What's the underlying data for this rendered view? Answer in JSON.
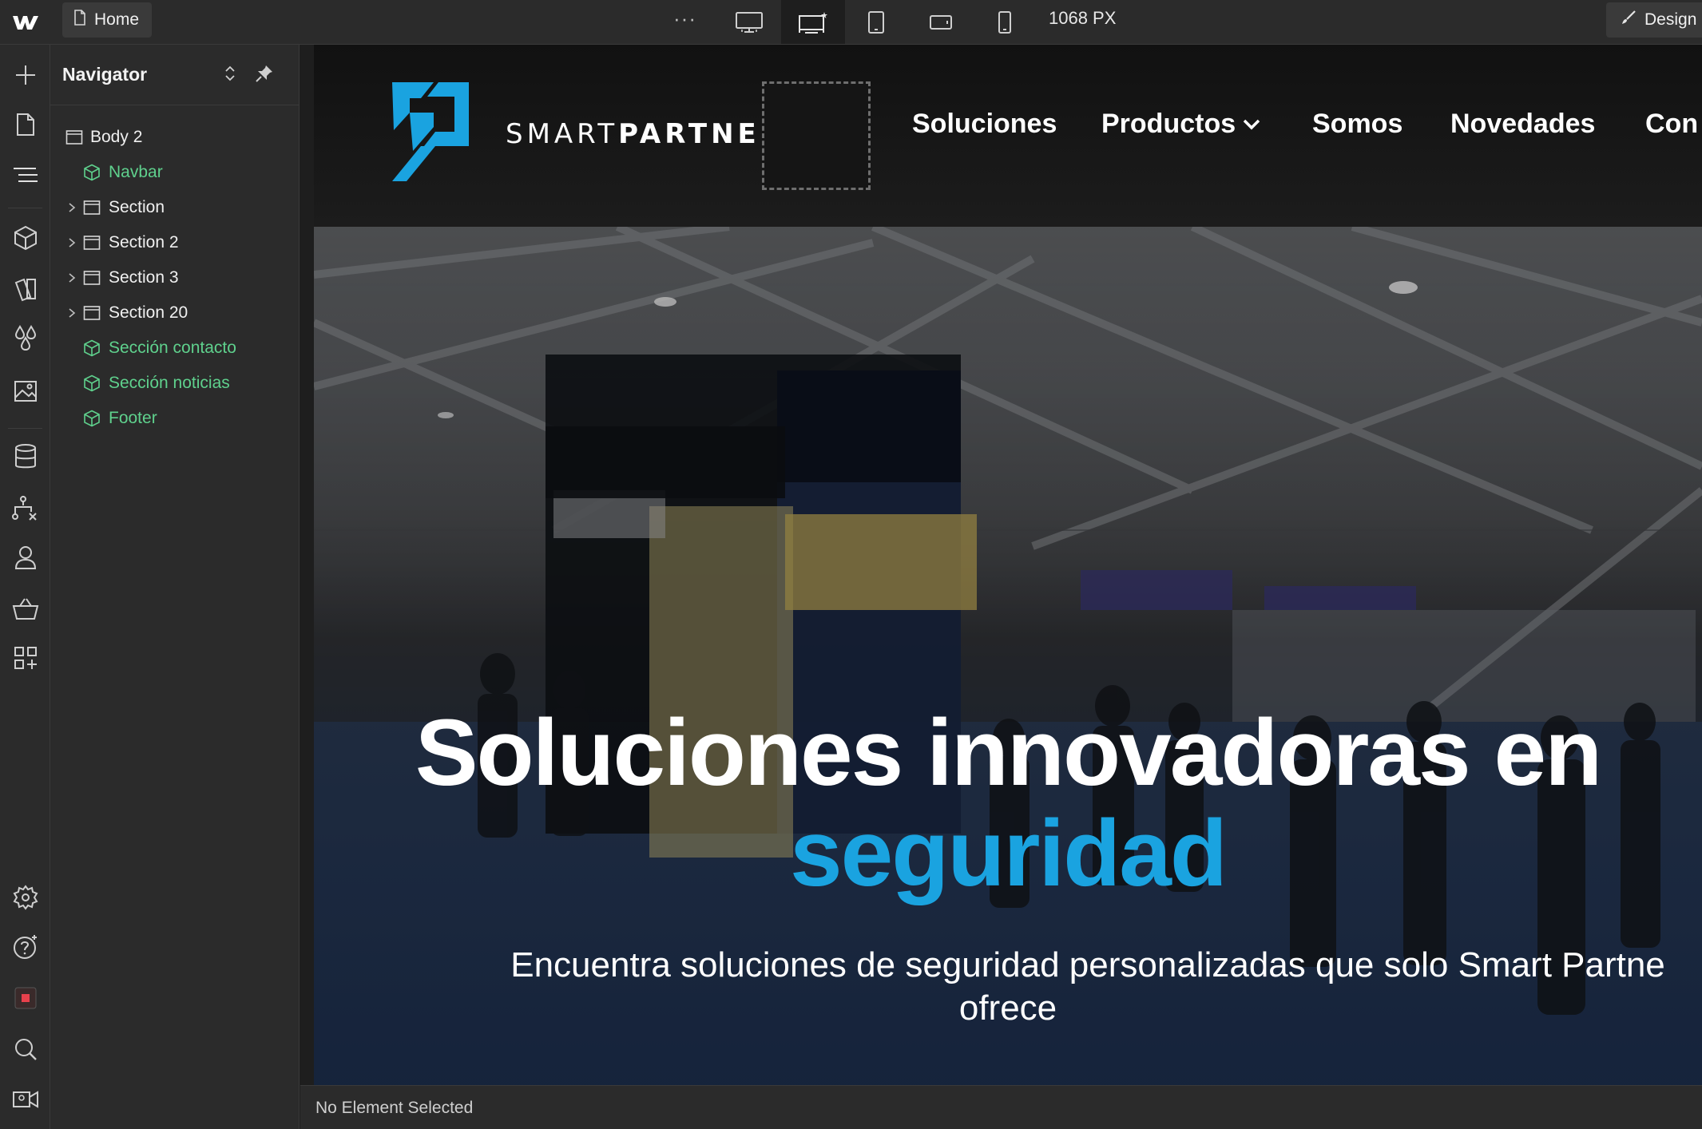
{
  "topbar": {
    "page_name": "Home",
    "more": "···",
    "width_readout": "1068 PX",
    "mode_label": "Design"
  },
  "navigator": {
    "title": "Navigator",
    "items": [
      {
        "label": "Body 2",
        "type": "element"
      },
      {
        "label": "Navbar",
        "type": "component"
      },
      {
        "label": "Section",
        "type": "element"
      },
      {
        "label": "Section 2",
        "type": "element"
      },
      {
        "label": "Section 3",
        "type": "element"
      },
      {
        "label": "Section 20",
        "type": "element"
      },
      {
        "label": "Sección contacto",
        "type": "component"
      },
      {
        "label": "Sección noticias",
        "type": "component"
      },
      {
        "label": "Footer",
        "type": "component"
      }
    ]
  },
  "site": {
    "brand_light": "SMART",
    "brand_bold": "PARTNERS",
    "menu": [
      "Soluciones",
      "Productos",
      "Somos",
      "Novedades",
      "Con"
    ],
    "hero_line1": "Soluciones innovadoras en",
    "hero_line2": "seguridad",
    "hero_sub_line1": "Encuentra soluciones de seguridad personalizadas que solo Smart Partne",
    "hero_sub_line2": "ofrece",
    "accent_color": "#1aa3e0"
  },
  "status": {
    "text": "No Element Selected"
  },
  "icons": {
    "rail": [
      "add-icon",
      "pages-icon",
      "navigator-icon",
      "components-icon",
      "variables-icon",
      "styles-icon",
      "assets-icon",
      "cms-icon",
      "logic-icon",
      "users-icon",
      "ecommerce-icon",
      "apps-icon",
      "settings-icon",
      "help-icon",
      "record-icon",
      "search-icon",
      "video-icon"
    ]
  }
}
